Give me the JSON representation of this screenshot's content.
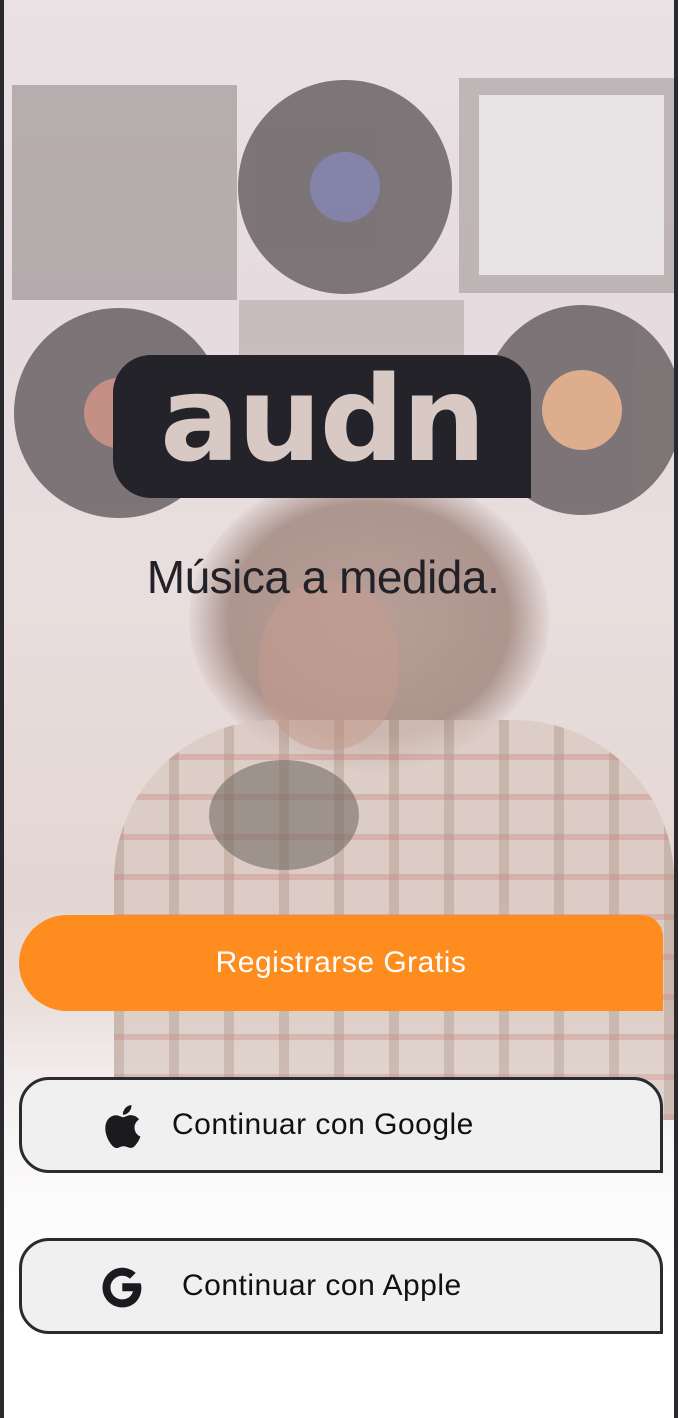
{
  "brand": {
    "logo_text": "audn",
    "tagline": "Música a medida."
  },
  "actions": {
    "register_label": "Registrarse Gratis",
    "google_label": "Continuar con Google",
    "apple_label": "Continuar con Apple"
  },
  "icons": {
    "first_button_icon": "apple-icon",
    "second_button_icon": "google-icon"
  },
  "colors": {
    "accent": "#FF8C1F",
    "logo_bg": "#24232A",
    "text_dark": "#222127",
    "button_border": "#2A2A30"
  }
}
